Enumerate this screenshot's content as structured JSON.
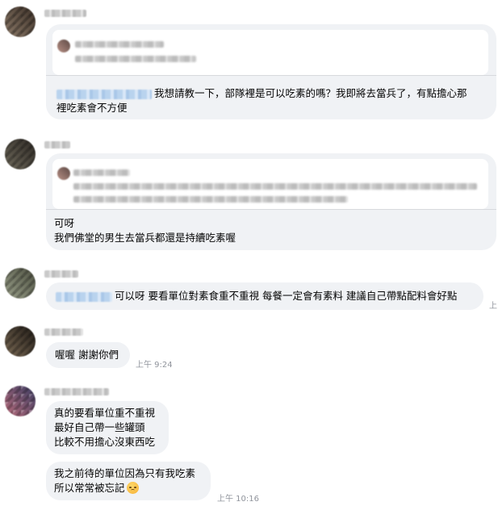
{
  "messages": [
    {
      "id": "m1",
      "text": "我想請教一下，部隊裡是可以吃素的嗎？我即將去當兵了，有點擔心那",
      "text_line2": "裡吃素會不方便"
    },
    {
      "id": "m2",
      "line1": "可呀",
      "line2": "我們佛堂的男生去當兵都還是持續吃素喔"
    },
    {
      "id": "m3",
      "text": "可以呀 要看單位對素食重不重視  每餐一定會有素料 建議自己帶點配料會好點",
      "timestamp_partial": "上"
    },
    {
      "id": "m4",
      "text": "喔喔 謝謝你們",
      "timestamp": "上午 9:24"
    },
    {
      "id": "m5",
      "line1": "真的要看單位重不重視",
      "line2": "最好自己帶一些罐頭",
      "line3": "比較不用擔心沒東西吃"
    },
    {
      "id": "m6",
      "line1": "我之前待的單位因為只有我吃素",
      "line2": "所以常常被忘記",
      "emoji": "disappointed-face-icon",
      "timestamp": "上午 10:16"
    }
  ],
  "colors": {
    "bubble_bg": "#f0f2f5",
    "quote_bg": "#ffffff",
    "timestamp": "#90949c",
    "mention_blur": "#b9d3ee"
  }
}
